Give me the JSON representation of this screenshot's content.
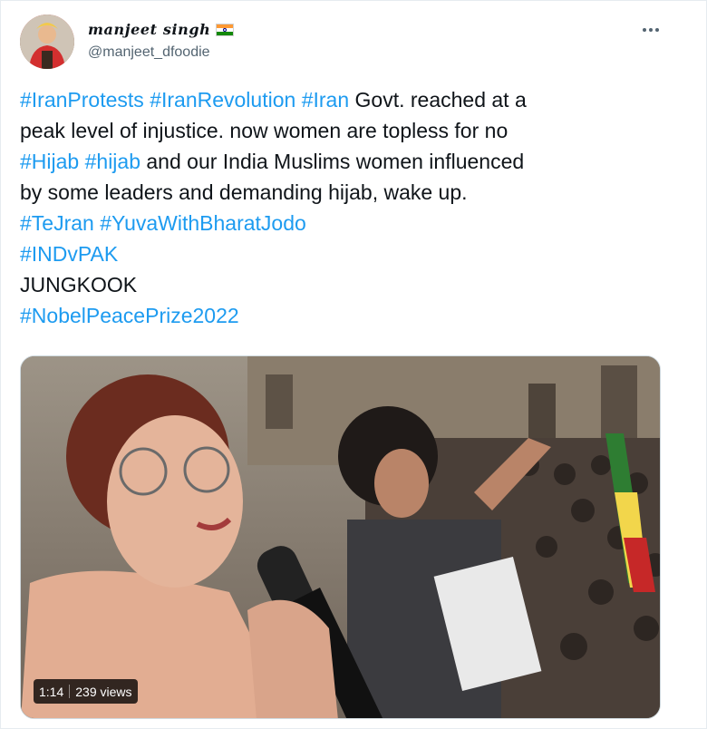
{
  "user": {
    "display_name": "manjeet singh",
    "handle": "@manjeet_dfoodie",
    "flag": "india-flag-icon"
  },
  "menu": {
    "icon": "more-horizontal-icon"
  },
  "tweet": {
    "segments": [
      {
        "text": "#IranProtests",
        "type": "hashtag"
      },
      {
        "text": " ",
        "type": "text"
      },
      {
        "text": "#IranRevolution",
        "type": "hashtag"
      },
      {
        "text": " ",
        "type": "text"
      },
      {
        "text": "#Iran",
        "type": "hashtag"
      },
      {
        "text": " Govt. reached at a\npeak level of injustice. now women are topless for no\n",
        "type": "text"
      },
      {
        "text": "#Hijab",
        "type": "hashtag"
      },
      {
        "text": " ",
        "type": "text"
      },
      {
        "text": "#hijab",
        "type": "hashtag"
      },
      {
        "text": " and our India Muslims women influenced\nby some leaders and demanding hijab, wake up.\n",
        "type": "text"
      },
      {
        "text": "#TeJran",
        "type": "hashtag"
      },
      {
        "text": " ",
        "type": "text"
      },
      {
        "text": "#YuvaWithBharatJodo",
        "type": "hashtag"
      },
      {
        "text": "\n",
        "type": "text"
      },
      {
        "text": "#INDvPAK",
        "type": "hashtag"
      },
      {
        "text": "\nJUNGKOOK\n",
        "type": "text"
      },
      {
        "text": "#NobelPeacePrize2022",
        "type": "hashtag"
      }
    ]
  },
  "media": {
    "duration": "1:14",
    "views": "239 views"
  },
  "colors": {
    "accent": "#1d9bf0",
    "text": "#0f1419",
    "secondary": "#536471"
  }
}
